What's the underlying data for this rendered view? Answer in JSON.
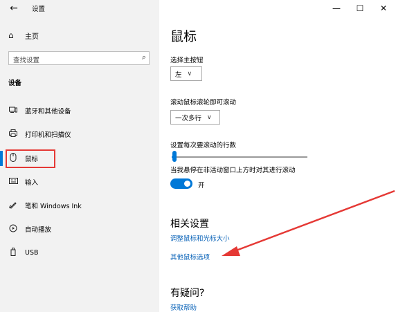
{
  "titlebar": {
    "back_icon": "←",
    "title": "设置",
    "minimize": "—",
    "maximize": "☐",
    "close": "✕"
  },
  "sidebar": {
    "home_label": "主页",
    "search_placeholder": "查找设置",
    "section_title": "设备",
    "items": [
      {
        "label": "蓝牙和其他设备",
        "icon": "bluetooth-devices-icon"
      },
      {
        "label": "打印机和扫描仪",
        "icon": "printer-icon"
      },
      {
        "label": "鼠标",
        "icon": "mouse-icon",
        "selected": true
      },
      {
        "label": "输入",
        "icon": "keyboard-icon"
      },
      {
        "label": "笔和 Windows Ink",
        "icon": "pen-icon"
      },
      {
        "label": "自动播放",
        "icon": "autoplay-icon"
      },
      {
        "label": "USB",
        "icon": "usb-icon"
      }
    ]
  },
  "main": {
    "title": "鼠标",
    "primary_button_label": "选择主按钮",
    "primary_button_value": "左",
    "scroll_mode_label": "滚动鼠标滚轮即可滚动",
    "scroll_mode_value": "一次多行",
    "lines_label": "设置每次要滚动的行数",
    "lines_slider_fraction": 0.02,
    "inactive_scroll_label": "当我悬停在非活动窗口上方时对其进行滚动",
    "toggle_state": "开",
    "related_heading": "相关设置",
    "related_links": [
      "调整鼠标和光标大小",
      "其他鼠标选项"
    ],
    "question_heading": "有疑问?",
    "help_link": "获取帮助"
  },
  "colors": {
    "accent": "#0078d7",
    "link": "#0a63b8",
    "annotation_red": "#e53935",
    "sidebar_bg": "#f2f2f2"
  }
}
